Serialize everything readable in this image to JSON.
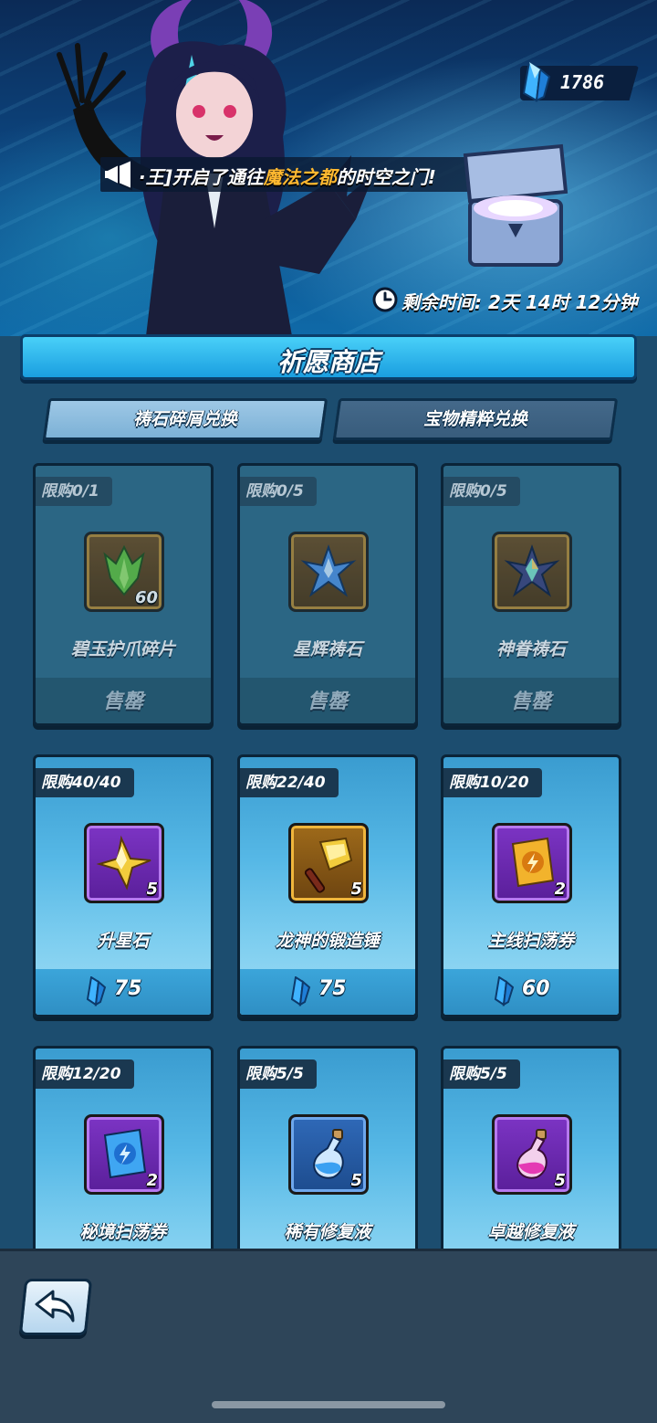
{
  "header": {
    "currency": {
      "value": "1786",
      "icon": "blue-crystal-icon"
    },
    "announcement": {
      "prefix": "·王]开启了通往",
      "highlight": "魔法之都",
      "suffix": "的时空之门!",
      "highlight_color": "#ffb830"
    },
    "timer": {
      "label": "剩余时间: 2天 14时 12分钟",
      "icon": "clock-icon"
    }
  },
  "shop": {
    "title": "祈愿商店",
    "tabs": [
      {
        "label": "祷石碎屑兑换",
        "active": true
      },
      {
        "label": "宝物精粹兑换",
        "active": false
      }
    ],
    "items": [
      {
        "limit": "限购0/1",
        "name": "碧玉护爪碎片",
        "qty": "60",
        "status": "sold",
        "sold_label": "售罄",
        "frame": "brown",
        "icon": "jade-claw-fragment-icon"
      },
      {
        "limit": "限购0/5",
        "name": "星辉祷石",
        "qty": "",
        "status": "sold",
        "sold_label": "售罄",
        "frame": "brown",
        "icon": "star-prayer-stone-icon"
      },
      {
        "limit": "限购0/5",
        "name": "神眷祷石",
        "qty": "",
        "status": "sold",
        "sold_label": "售罄",
        "frame": "brown",
        "icon": "divine-prayer-stone-icon"
      },
      {
        "limit": "限购40/40",
        "name": "升星石",
        "qty": "5",
        "status": "available",
        "price": "75",
        "frame": "purple",
        "icon": "star-up-stone-icon"
      },
      {
        "limit": "限购22/40",
        "name": "龙神的锻造锤",
        "qty": "5",
        "status": "available",
        "price": "75",
        "frame": "gold",
        "icon": "forge-hammer-icon"
      },
      {
        "limit": "限购10/20",
        "name": "主线扫荡券",
        "qty": "2",
        "status": "available",
        "price": "60",
        "frame": "purple",
        "icon": "main-sweep-ticket-icon"
      },
      {
        "limit": "限购12/20",
        "name": "秘境扫荡券",
        "qty": "2",
        "status": "available",
        "price": "",
        "frame": "purple",
        "icon": "secret-sweep-ticket-icon"
      },
      {
        "limit": "限购5/5",
        "name": "稀有修复液",
        "qty": "5",
        "status": "available",
        "price": "",
        "frame": "blue",
        "icon": "blue-potion-icon"
      },
      {
        "limit": "限购5/5",
        "name": "卓越修复液",
        "qty": "5",
        "status": "available",
        "price": "",
        "frame": "purple",
        "icon": "pink-potion-icon"
      }
    ]
  },
  "footer": {
    "back_icon": "back-arrow-icon"
  }
}
